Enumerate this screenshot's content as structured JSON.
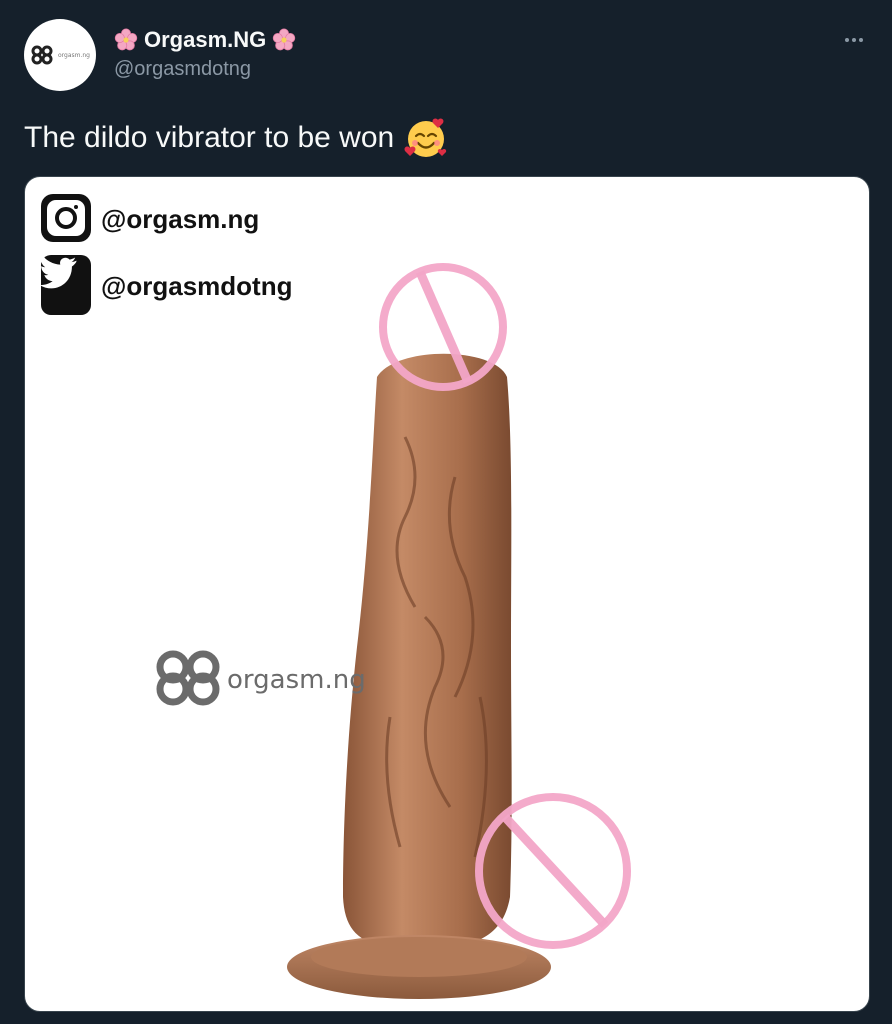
{
  "tweet": {
    "display_name": "Orgasm.NG",
    "handle": "@orgasmdotng",
    "text": "The dildo vibrator to be won",
    "emoji_icon": "smiling-face-with-hearts-icon",
    "flower_icon": "cherry-blossom-icon"
  },
  "avatar": {
    "logo_text": "orgasm.ng"
  },
  "media": {
    "instagram_handle": "@orgasm.ng",
    "twitter_handle": "@orgasmdotng",
    "watermark": "orgasm.ng",
    "censor_color": "#f3a6c8"
  },
  "colors": {
    "background": "#15202b",
    "secondary_text": "#8b98a5",
    "primary_text": "#f7f9f9"
  }
}
